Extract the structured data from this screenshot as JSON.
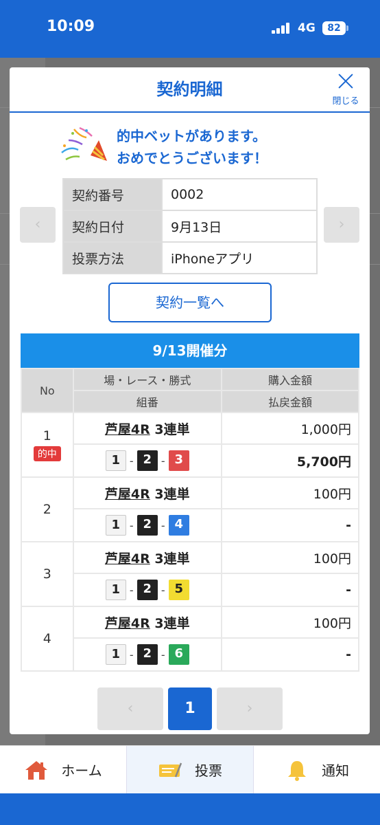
{
  "status": {
    "time": "10:09",
    "network": "4G",
    "battery": "82"
  },
  "modal": {
    "title": "契約明細",
    "close_label": "閉じる",
    "congrats_line1": "的中ベットがあります。",
    "congrats_line2": "おめでとうございます！",
    "info": [
      {
        "key": "契約番号",
        "value": "0002"
      },
      {
        "key": "契約日付",
        "value": "9月13日"
      },
      {
        "key": "投票方法",
        "value": "iPhoneアプリ"
      }
    ],
    "prev_arrow": "‹",
    "next_arrow": "›",
    "list_button": "契約一覧へ",
    "day_header": "9/13開催分",
    "table_headers": {
      "no": "No",
      "race": "場・レース・勝式",
      "combo": "組番",
      "purchase": "購入金額",
      "payout": "払戻金額"
    },
    "bets": [
      {
        "no": "1",
        "hit": "的中",
        "venue": "芦屋4R",
        "type": "3連単",
        "combo": [
          "1",
          "2",
          "3"
        ],
        "purchase": "1,000円",
        "payout": "5,700円"
      },
      {
        "no": "2",
        "venue": "芦屋4R",
        "type": "3連単",
        "combo": [
          "1",
          "2",
          "4"
        ],
        "purchase": "100円",
        "payout": "-"
      },
      {
        "no": "3",
        "venue": "芦屋4R",
        "type": "3連単",
        "combo": [
          "1",
          "2",
          "5"
        ],
        "purchase": "100円",
        "payout": "-"
      },
      {
        "no": "4",
        "venue": "芦屋4R",
        "type": "3連単",
        "combo": [
          "1",
          "2",
          "6"
        ],
        "purchase": "100円",
        "payout": "-"
      }
    ],
    "combo_dash": "-",
    "pager": {
      "prev": "‹",
      "current": "1",
      "next": "›"
    }
  },
  "tabs": [
    {
      "label": "ホーム",
      "icon": "home-icon"
    },
    {
      "label": "投票",
      "icon": "ticket-icon"
    },
    {
      "label": "通知",
      "icon": "bell-icon"
    }
  ],
  "colors": {
    "primary": "#1a67d2",
    "hit": "#e33b3b",
    "header_bar": "#1a8fe8"
  }
}
